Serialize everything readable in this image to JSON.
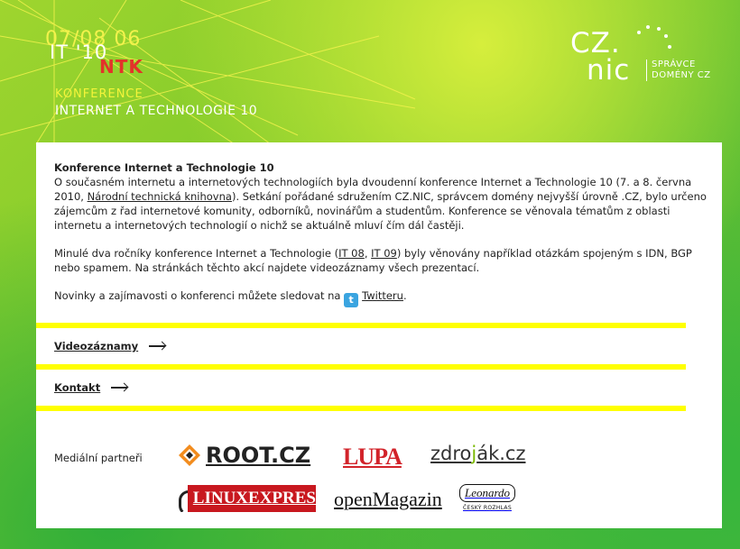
{
  "header": {
    "date": "07/08 06",
    "event_code": "IT '10",
    "venue_code": "NTK",
    "kicker": "KONFERENCE",
    "title": "INTERNET A TECHNOLOGIE 10"
  },
  "logo": {
    "line1": "CZ.",
    "line2": "nic",
    "tag1": "SPRÁVCE",
    "tag2": "DOMÉNY CZ"
  },
  "intro": {
    "heading": "Konference Internet a Technologie 10",
    "p1_a": "O současném internetu a internetových technologiích byla dvoudenní konference Internet a Technologie 10 (7. a 8. června 2010, ",
    "p1_link": "Národní technická knihovna",
    "p1_b": "). Setkání pořádané sdružením CZ.NIC, správcem domény nejvyšší úrovně .CZ, bylo určeno zájemcům z řad internetové komunity, odborníků, novinářům a studentům. Konference se věnovala tématům z oblasti internetu a internetových technologií o nichž se aktuálně mluví čím dál častěji.",
    "p2_a": "Minulé dva ročníky konference Internet a Technologie (",
    "p2_link1": "IT 08",
    "p2_sep": ", ",
    "p2_link2": "IT 09",
    "p2_b": ") byly věnovány například otázkám spojeným s IDN, BGP nebo spamem. Na stránkách těchto akcí najdete videozáznamy všech prezentací.",
    "p3_a": "Novinky a zajímavosti o konferenci můžete sledovat na ",
    "p3_link": "Twitteru",
    "p3_b": "."
  },
  "nav": {
    "videos": "Videozáznamy",
    "contact": "Kontakt"
  },
  "partners": {
    "label": "Mediální partneři",
    "root": "ROOT.CZ",
    "lupa": "LUPA",
    "zdrojak_a": "zdro",
    "zdrojak_j": "j",
    "zdrojak_b": "ák.cz",
    "linux": "LINUXEXPRES",
    "openmagazin": "openMagazin",
    "leonardo": "Leonardo",
    "leonardo_sub": "ČESKÝ ROZHLAS"
  },
  "colors": {
    "accent_yellow": "#ffff00",
    "ntk_red": "#e3332a",
    "lupa_red": "#d2232a",
    "linux_red": "#c8181f",
    "twitter_blue": "#3aa4e0"
  },
  "icons": [
    "twitter-icon",
    "arrow-right-icon",
    "root-logo-icon",
    "linux-pen-icon"
  ]
}
